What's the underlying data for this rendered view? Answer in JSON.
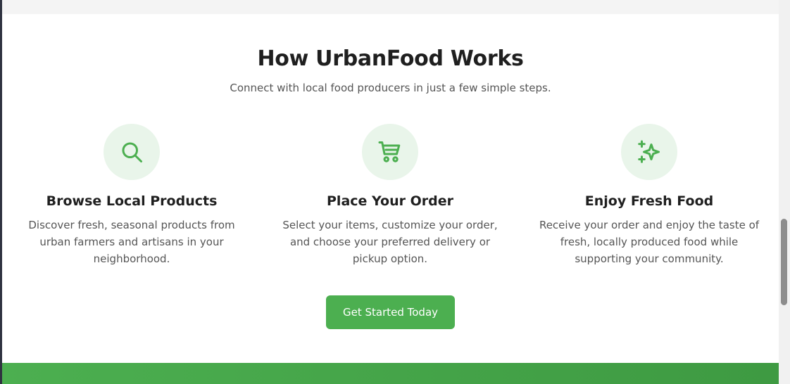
{
  "section": {
    "title": "How UrbanFood Works",
    "subtitle": "Connect with local food producers in just a few simple steps."
  },
  "steps": [
    {
      "icon": "search-icon",
      "title": "Browse Local Products",
      "description": "Discover fresh, seasonal products from urban farmers and artisans in your neighborhood."
    },
    {
      "icon": "shopping-cart-icon",
      "title": "Place Your Order",
      "description": "Select your items, customize your order, and choose your preferred delivery or pickup option."
    },
    {
      "icon": "sparkles-icon",
      "title": "Enjoy Fresh Food",
      "description": "Receive your order and enjoy the taste of fresh, locally produced food while supporting your community."
    }
  ],
  "cta": {
    "label": "Get Started Today"
  },
  "colors": {
    "accent": "#4caf50",
    "icon_background": "#e9f5ea",
    "heading": "#1f1f1f",
    "body_text": "#555555"
  }
}
